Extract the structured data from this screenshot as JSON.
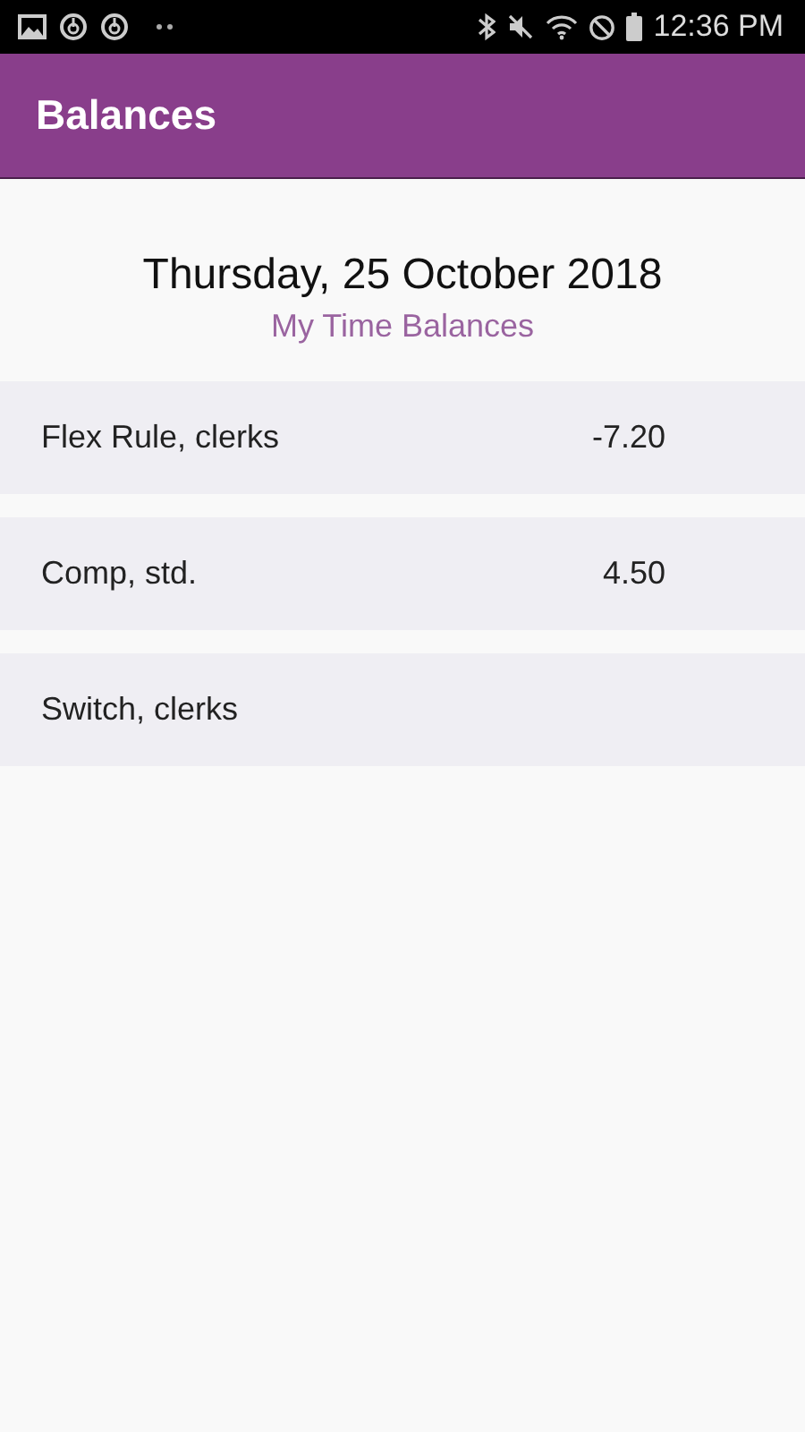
{
  "status_bar": {
    "time": "12:36 PM"
  },
  "app_bar": {
    "title": "Balances"
  },
  "header": {
    "date": "Thursday, 25 October 2018",
    "subtitle": "My Time Balances"
  },
  "balances": [
    {
      "name": "Flex Rule, clerks",
      "value": "-7.20"
    },
    {
      "name": "Comp, std.",
      "value": "4.50"
    },
    {
      "name": "Switch, clerks"
    }
  ]
}
